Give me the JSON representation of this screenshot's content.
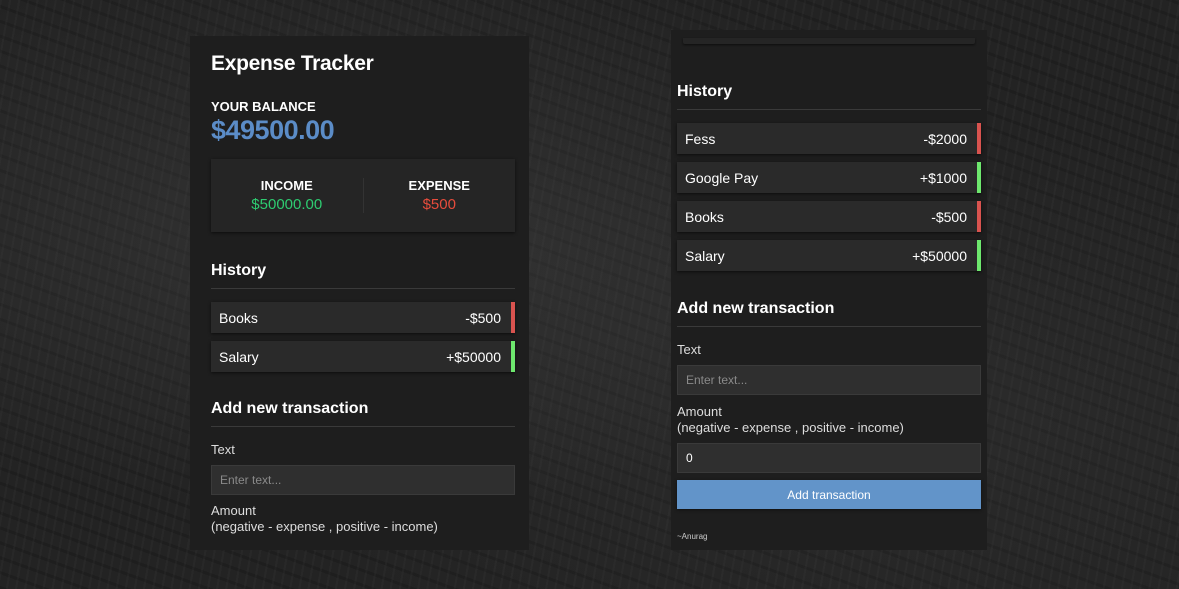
{
  "app": {
    "title": "Expense Tracker",
    "balance_label": "Your Balance",
    "balance_value": "$49500.00"
  },
  "summary": {
    "income_label": "Income",
    "income_value": "$50000.00",
    "expense_label": "Expense",
    "expense_value": "$500"
  },
  "colors": {
    "accent": "#5b8cc7",
    "income": "#2ecc71",
    "expense": "#e74c3c",
    "button": "#6294c9"
  },
  "left_panel": {
    "history_title": "History",
    "history": [
      {
        "text": "Books",
        "amount": "-$500",
        "type": "expense"
      },
      {
        "text": "Salary",
        "amount": "+$50000",
        "type": "income"
      }
    ],
    "add_title": "Add new transaction",
    "text_label": "Text",
    "text_placeholder": "Enter text...",
    "amount_label": "Amount",
    "amount_hint": "(negative - expense , positive - income)"
  },
  "right_panel": {
    "history_title": "History",
    "history": [
      {
        "text": "Fess",
        "amount": "-$2000",
        "type": "expense"
      },
      {
        "text": "Google Pay",
        "amount": "+$1000",
        "type": "income"
      },
      {
        "text": "Books",
        "amount": "-$500",
        "type": "expense"
      },
      {
        "text": "Salary",
        "amount": "+$50000",
        "type": "income"
      }
    ],
    "add_title": "Add new transaction",
    "text_label": "Text",
    "text_placeholder": "Enter text...",
    "amount_label": "Amount",
    "amount_hint": "(negative - expense , positive - income)",
    "amount_value": "0",
    "button_label": "Add transaction",
    "credit": "~Anurag"
  }
}
